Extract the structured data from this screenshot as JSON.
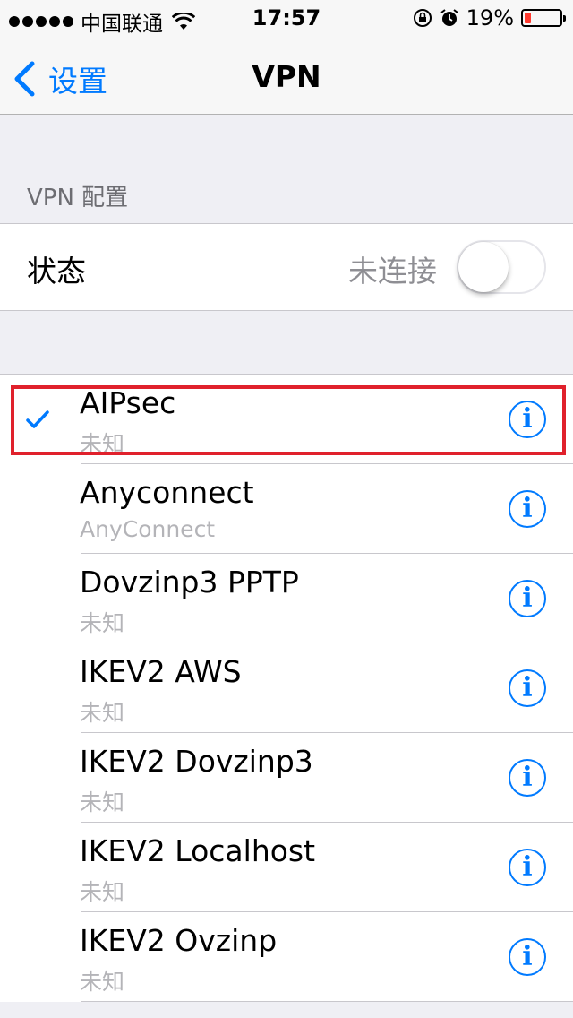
{
  "status_bar": {
    "carrier": "中国联通",
    "time": "17:57",
    "battery_percent": "19%",
    "battery_level": 0.19,
    "icons": [
      "signal-dots-icon",
      "wifi-icon",
      "orientation-lock-icon",
      "alarm-icon",
      "battery-icon"
    ]
  },
  "nav": {
    "back_label": "设置",
    "title": "VPN"
  },
  "config_section": {
    "header": "VPN 配置",
    "status_label": "状态",
    "status_value": "未连接",
    "toggle_on": false
  },
  "vpn_list": [
    {
      "name": "AIPsec",
      "type": "未知",
      "selected": true
    },
    {
      "name": "Anyconnect",
      "type": "AnyConnect",
      "selected": false
    },
    {
      "name": "Dovzinp3 PPTP",
      "type": "未知",
      "selected": false
    },
    {
      "name": "IKEV2 AWS",
      "type": "未知",
      "selected": false
    },
    {
      "name": "IKEV2 Dovzinp3",
      "type": "未知",
      "selected": false
    },
    {
      "name": "IKEV2 Localhost",
      "type": "未知",
      "selected": false
    },
    {
      "name": "IKEV2 Ovzinp",
      "type": "未知",
      "selected": false
    }
  ],
  "colors": {
    "accent": "#007aff",
    "highlight": "#e0212c",
    "battery_low": "#ff3b30",
    "background": "#efeff4"
  }
}
